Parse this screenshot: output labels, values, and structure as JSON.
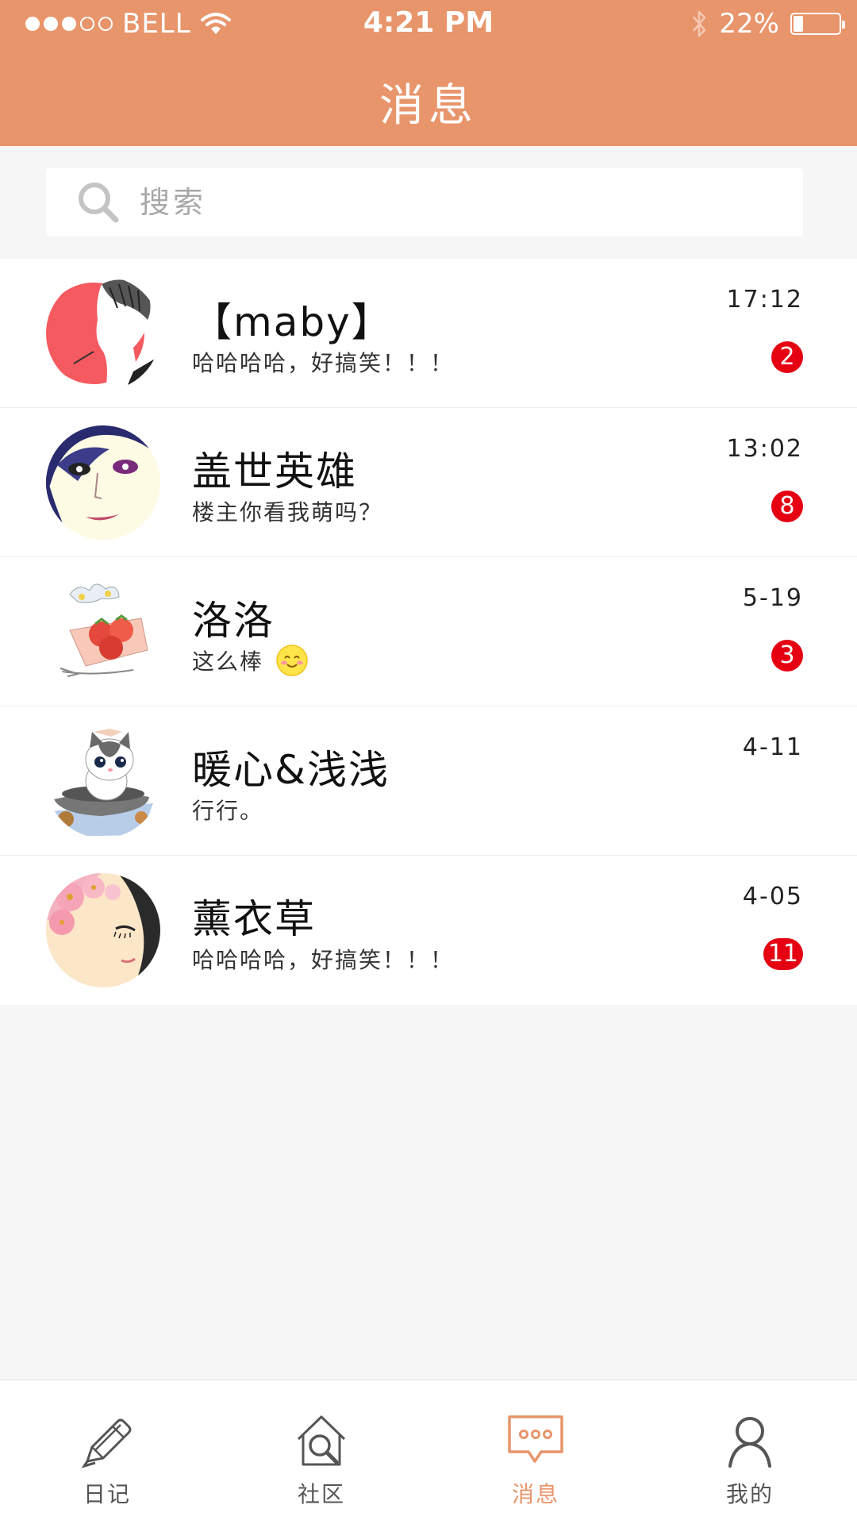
{
  "status_bar": {
    "carrier": "BELL",
    "time": "4:21 PM",
    "battery_percent": "22%",
    "battery_level": 0.22,
    "signal_strength": 3,
    "signal_max": 5
  },
  "header": {
    "title": "消息"
  },
  "search": {
    "placeholder": "搜索",
    "value": ""
  },
  "conversations": [
    {
      "name": "【maby】",
      "preview": "哈哈哈哈，好搞笑！！！",
      "time": "17:12",
      "unread": "2",
      "avatar": "avatar-maby",
      "emoji": false
    },
    {
      "name": "盖世英雄",
      "preview": "楼主你看我萌吗？",
      "time": "13:02",
      "unread": "8",
      "avatar": "avatar-gaishiyingxiong",
      "emoji": false
    },
    {
      "name": "洛洛",
      "preview": "这么棒",
      "time": "5-19",
      "unread": "3",
      "avatar": "avatar-luoluo",
      "emoji": true
    },
    {
      "name": "暖心&浅浅",
      "preview": "行行。",
      "time": "4-11",
      "unread": "",
      "avatar": "avatar-nuanxin",
      "emoji": false
    },
    {
      "name": "薰衣草",
      "preview": "哈哈哈哈，好搞笑！！！",
      "time": "4-05",
      "unread": "11",
      "avatar": "avatar-xunyicao",
      "emoji": false
    }
  ],
  "tabs": [
    {
      "label": "日记",
      "icon": "pencil-icon",
      "active": false
    },
    {
      "label": "社区",
      "icon": "community-search-icon",
      "active": false
    },
    {
      "label": "消息",
      "icon": "chat-bubble-icon",
      "active": true
    },
    {
      "label": "我的",
      "icon": "person-icon",
      "active": false
    }
  ],
  "colors": {
    "header": "#e8956b",
    "badge": "#e50012",
    "active_tab": "#e8956b",
    "background": "#f6f6f6"
  }
}
